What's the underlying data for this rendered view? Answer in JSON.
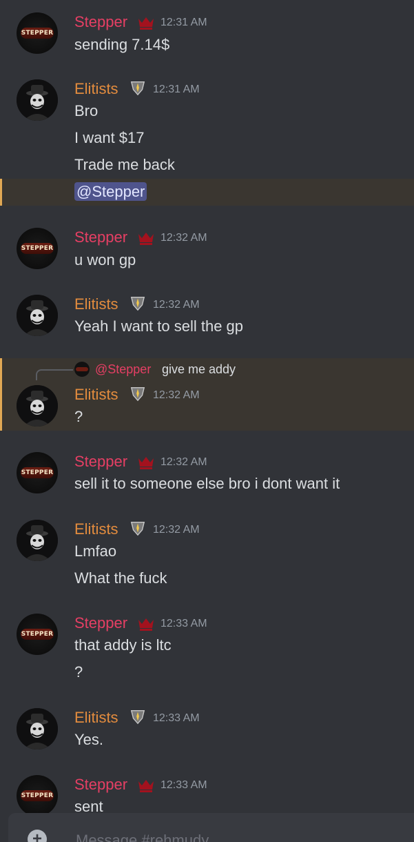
{
  "composer": {
    "placeholder": "Message #rehmudy",
    "plus_glyph": "+"
  },
  "messages": [
    {
      "author": "Stepper",
      "avatar_text": "STEPPER",
      "time": "12:31 AM",
      "lines": [
        "sending 7.14$"
      ]
    },
    {
      "author": "Elitists",
      "time": "12:31 AM",
      "lines": [
        "Bro",
        "I want $17",
        "Trade me back"
      ],
      "mention": "@Stepper"
    },
    {
      "author": "Stepper",
      "avatar_text": "STEPPER",
      "time": "12:32 AM",
      "lines": [
        "u won gp"
      ]
    },
    {
      "author": "Elitists",
      "time": "12:32 AM",
      "lines": [
        "Yeah I want to sell the gp"
      ]
    },
    {
      "author": "Elitists",
      "time": "12:32 AM",
      "lines": [
        "?"
      ],
      "reply": {
        "name": "@Stepper",
        "text": "give me addy"
      }
    },
    {
      "author": "Stepper",
      "avatar_text": "STEPPER",
      "time": "12:32 AM",
      "lines": [
        "sell it to someone else bro i dont want it"
      ]
    },
    {
      "author": "Elitists",
      "time": "12:32 AM",
      "lines": [
        "Lmfao",
        "What the fuck"
      ]
    },
    {
      "author": "Stepper",
      "avatar_text": "STEPPER",
      "time": "12:33 AM",
      "lines": [
        "that addy is ltc",
        "?"
      ]
    },
    {
      "author": "Elitists",
      "time": "12:33 AM",
      "lines": [
        "Yes."
      ]
    },
    {
      "author": "Stepper",
      "avatar_text": "STEPPER",
      "time": "12:33 AM",
      "lines": [
        "sent"
      ]
    }
  ],
  "colors": {
    "stepper_name": "#e63f64",
    "elitists_name": "#e38c3e",
    "mention_bg": "#4f548c",
    "highlight_bar": "#e0a854"
  },
  "icons": {
    "stepper_badge": "crown-icon",
    "elitists_badge": "shield-badge-icon"
  }
}
